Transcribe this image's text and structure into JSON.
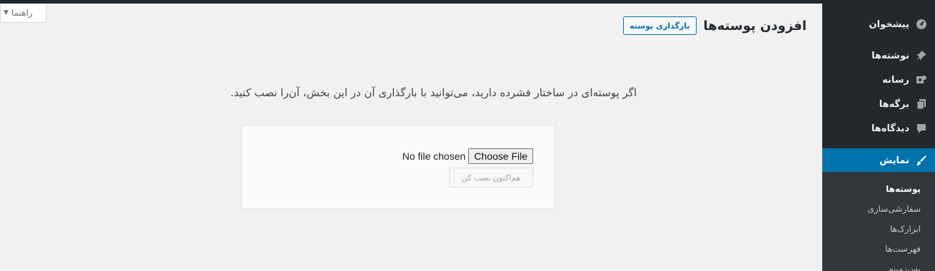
{
  "help_tab": {
    "label": "راهنما",
    "arrow_icon": "caret-down-icon"
  },
  "page": {
    "title": "افزودن پوسته‌ها",
    "upload_button": "بارگذاری پوسته",
    "help_text": "اگر پوسته‌ای در ساختار فشرده دارید، می‌توانید با بارگذاری آن در این بخش، آن‌را نصب کنید.",
    "file_input": {
      "status": "No file chosen",
      "button": "Choose File"
    },
    "install_button": "هم‌اکنون نصب کن"
  },
  "sidebar": {
    "items": [
      {
        "label": "پیشخوان",
        "icon": "dashboard-icon"
      },
      {
        "label": "نوشته‌ها",
        "icon": "pin-icon"
      },
      {
        "label": "رسانه",
        "icon": "media-icon"
      },
      {
        "label": "برگه‌ها",
        "icon": "pages-icon"
      },
      {
        "label": "دیدگاه‌ها",
        "icon": "comments-icon"
      },
      {
        "label": "نمایش",
        "icon": "appearance-icon",
        "current": true
      }
    ],
    "submenu": [
      {
        "label": "پوسته‌ها",
        "active": true
      },
      {
        "label": "سفارشی‌سازی"
      },
      {
        "label": "ابزارک‌ها"
      },
      {
        "label": "فهرست‌ها"
      },
      {
        "label": "پس‌زمینه"
      }
    ]
  },
  "colors": {
    "accent": "#0073aa",
    "sidebar_bg": "#23282d",
    "submenu_bg": "#32373c",
    "page_bg": "#f1f1f1"
  }
}
